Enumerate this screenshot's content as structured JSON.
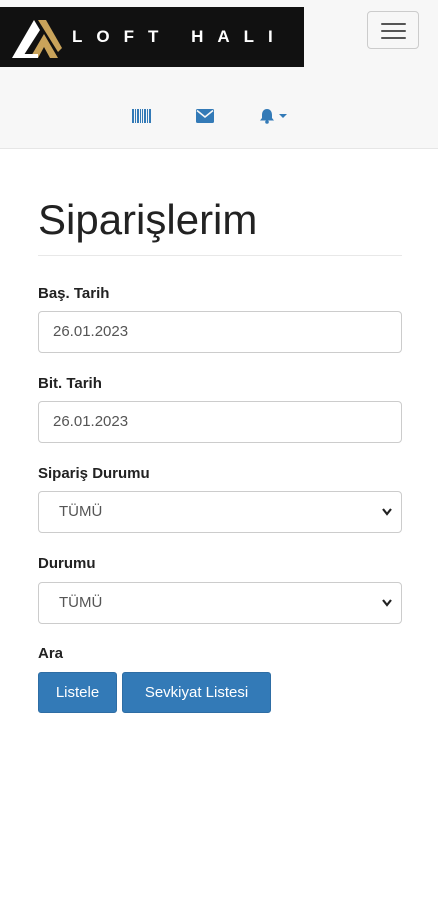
{
  "brand": {
    "name": "LOFT HALI"
  },
  "header": {
    "menu_toggle_icon": "hamburger-icon",
    "icons": [
      "barcode-icon",
      "envelope-icon",
      "bell-icon"
    ]
  },
  "page": {
    "title": "Siparişlerim"
  },
  "form": {
    "start_date": {
      "label": "Baş. Tarih",
      "value": "26.01.2023"
    },
    "end_date": {
      "label": "Bit. Tarih",
      "value": "26.01.2023"
    },
    "order_status": {
      "label": "Sipariş Durumu",
      "selected": "TÜMÜ"
    },
    "status": {
      "label": "Durumu",
      "selected": "TÜMÜ"
    },
    "search": {
      "label": "Ara"
    },
    "buttons": {
      "list": "Listele",
      "shipment_list": "Sevkiyat Listesi"
    }
  },
  "colors": {
    "primary": "#337ab7",
    "brand_bg": "#111111",
    "logo_gold": "#c9a35a",
    "icon_blue": "#337ab7"
  }
}
